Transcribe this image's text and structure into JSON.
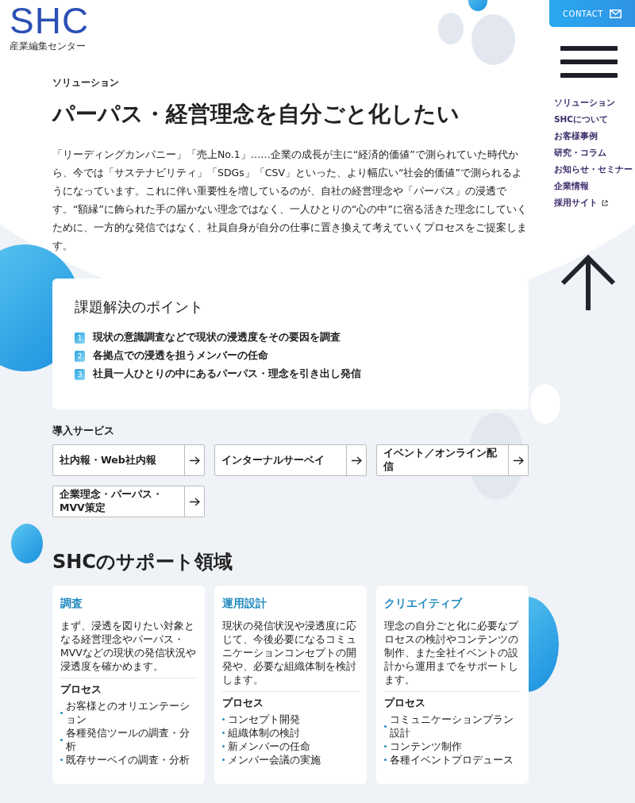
{
  "logo": {
    "mark": "SHC",
    "subtitle": "産業編集センター"
  },
  "contact": {
    "label": "CONTACT"
  },
  "nav": [
    {
      "label": "ソリューション",
      "external": false
    },
    {
      "label": "SHCについて",
      "external": false
    },
    {
      "label": "お客様事例",
      "external": false
    },
    {
      "label": "研究・コラム",
      "external": false
    },
    {
      "label": "お知らせ・セミナー",
      "external": false
    },
    {
      "label": "企業情報",
      "external": false
    },
    {
      "label": "採用サイト",
      "external": true
    }
  ],
  "hero": {
    "category": "ソリューション",
    "title": "パーパス・経営理念を自分ごと化したい",
    "body": "「リーディングカンパニー」「売上No.1」……企業の成長が主に“経済的価値”で測られていた時代から、今では「サステナビリティ」「SDGs」「CSV」といった、より幅広い“社会的価値”で測られるようになっています。これに伴い重要性を増しているのが、自社の経営理念や「パーパス」の浸透です。“額縁”に飾られた手の届かない理念ではなく、一人ひとりの“心の中”に宿る活きた理念にしていくために、一方的な発信ではなく、社員自身が自分の仕事に置き換えて考えていくプロセスをご提案します。"
  },
  "points": {
    "title": "課題解決のポイント",
    "items": [
      {
        "number": "1",
        "text": "現状の意識調査などで現状の浸透度をその要因を調査"
      },
      {
        "number": "2",
        "text": "各拠点での浸透を担うメンバーの任命"
      },
      {
        "number": "3",
        "text": "社員一人ひとりの中にあるパーパス・理念を引き出し発信"
      }
    ]
  },
  "services": {
    "title": "導入サービス",
    "items": [
      "社内報・Web社内報",
      "インターナルサーベイ",
      "イベント／オンライン配信",
      "企業理念・パーパス・MVV策定"
    ]
  },
  "support": {
    "title": "SHCのサポート領域",
    "cards": [
      {
        "title": "調査",
        "body": "まず、浸透を図りたい対象となる経営理念やパーパス・MVVなどの現状の発信状況や浸透度を確かめます。",
        "process_label": "プロセス",
        "process": [
          "お客様とのオリエンテーション",
          "各種発信ツールの調査・分析",
          "既存サーベイの調査・分析"
        ]
      },
      {
        "title": "運用設計",
        "body": "現状の発信状況や浸透度に応じて、今後必要になるコミュニケーションコンセプトの開発や、必要な組織体制を検討します。",
        "process_label": "プロセス",
        "process": [
          "コンセプト開発",
          "組織体制の検討",
          "新メンバーの任命",
          "メンバー会議の実施"
        ]
      },
      {
        "title": "クリエイティブ",
        "body": "理念の自分ごと化に必要なプロセスの検討やコンテンツの制作、また全社イベントの設計から運用までをサポートします。",
        "process_label": "プロセス",
        "process": [
          "コミュニケーションプラン設計",
          "コンテンツ制作",
          "各種イベントプロデュース"
        ]
      }
    ]
  }
}
